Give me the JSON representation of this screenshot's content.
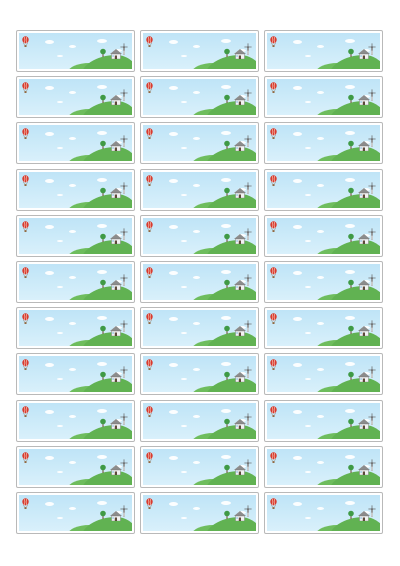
{
  "sheet": {
    "label_count": 33,
    "columns": 3,
    "rows": 11
  },
  "colors": {
    "sky": "#bfe4f7",
    "hill": "#61b252",
    "border": "#b9b9b9",
    "balloon": "#d83a2e"
  },
  "icons": [
    "hot-air-balloon-icon",
    "cloud-icon",
    "house-icon",
    "tree-icon",
    "windmill-icon"
  ]
}
